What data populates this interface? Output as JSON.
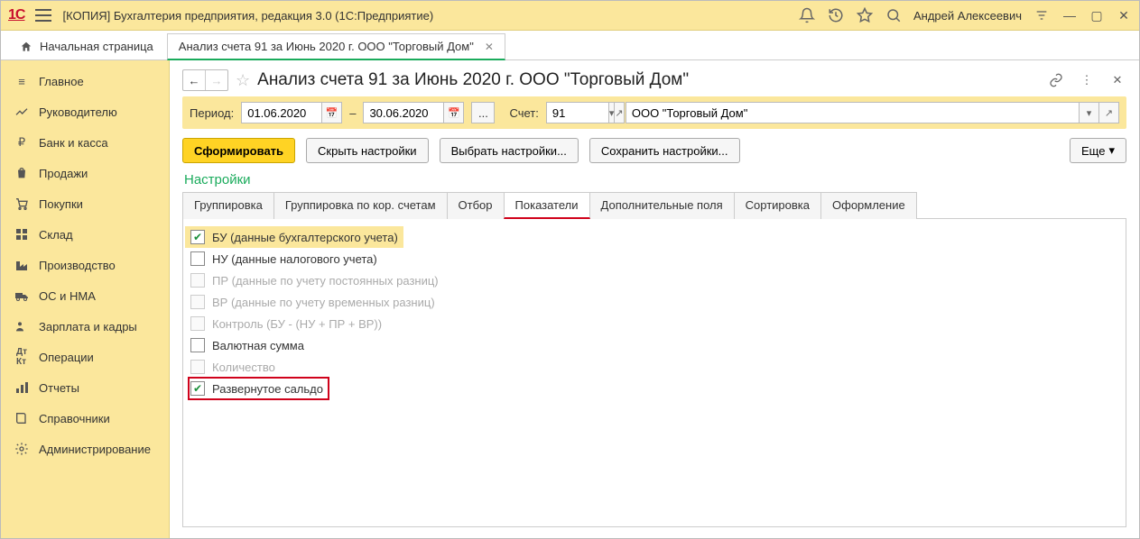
{
  "titlebar": {
    "logo_text": "1C",
    "title": "[КОПИЯ] Бухгалтерия предприятия, редакция 3.0  (1С:Предприятие)",
    "user_name": "Андрей Алексеевич"
  },
  "tabs": {
    "home_label": "Начальная страница",
    "active_label": "Анализ счета 91 за Июнь 2020 г. ООО \"Торговый Дом\""
  },
  "sidebar": {
    "items": [
      {
        "label": "Главное"
      },
      {
        "label": "Руководителю"
      },
      {
        "label": "Банк и касса"
      },
      {
        "label": "Продажи"
      },
      {
        "label": "Покупки"
      },
      {
        "label": "Склад"
      },
      {
        "label": "Производство"
      },
      {
        "label": "ОС и НМА"
      },
      {
        "label": "Зарплата и кадры"
      },
      {
        "label": "Операции"
      },
      {
        "label": "Отчеты"
      },
      {
        "label": "Справочники"
      },
      {
        "label": "Администрирование"
      }
    ]
  },
  "page": {
    "title": "Анализ счета 91 за Июнь 2020 г. ООО \"Торговый Дом\""
  },
  "filter": {
    "period_label": "Период:",
    "date_from": "01.06.2020",
    "dash": "–",
    "date_to": "30.06.2020",
    "account_label": "Счет:",
    "account_value": "91",
    "org_value": "ООО \"Торговый Дом\""
  },
  "actions": {
    "generate": "Сформировать",
    "hide_settings": "Скрыть настройки",
    "select_settings": "Выбрать настройки...",
    "save_settings": "Сохранить настройки...",
    "more": "Еще"
  },
  "settings": {
    "title": "Настройки",
    "tabs": [
      {
        "label": "Группировка"
      },
      {
        "label": "Группировка по кор. счетам"
      },
      {
        "label": "Отбор"
      },
      {
        "label": "Показатели",
        "active": true
      },
      {
        "label": "Дополнительные поля"
      },
      {
        "label": "Сортировка"
      },
      {
        "label": "Оформление"
      }
    ],
    "indicators": [
      {
        "label": "БУ (данные бухгалтерского учета)",
        "checked": true,
        "selected": true
      },
      {
        "label": "НУ (данные налогового учета)",
        "checked": false
      },
      {
        "label": "ПР (данные по учету постоянных разниц)",
        "checked": false,
        "disabled": true
      },
      {
        "label": "ВР (данные по учету временных разниц)",
        "checked": false,
        "disabled": true
      },
      {
        "label": "Контроль (БУ - (НУ + ПР + ВР))",
        "checked": false,
        "disabled": true
      },
      {
        "label": "Валютная сумма",
        "checked": false
      },
      {
        "label": "Количество",
        "checked": false,
        "disabled": true
      },
      {
        "label": "Развернутое сальдо",
        "checked": true,
        "highlighted": true
      }
    ]
  }
}
